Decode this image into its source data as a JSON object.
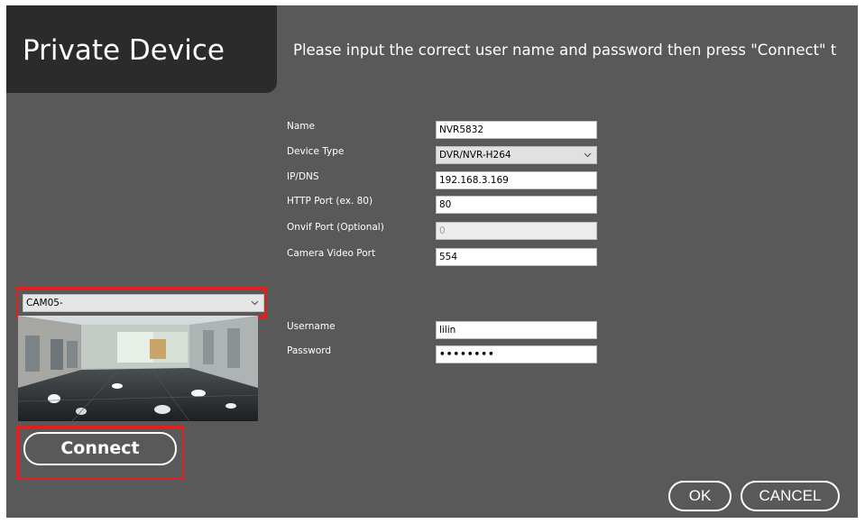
{
  "title": "Private Device",
  "instruction": "Please input the correct user name and password then press \"Connect\" t",
  "form": {
    "name": {
      "label": "Name",
      "value": "NVR5832"
    },
    "device_type": {
      "label": "Device Type",
      "value": "DVR/NVR-H264"
    },
    "ip_dns": {
      "label": "IP/DNS",
      "value": "192.168.3.169"
    },
    "http_port": {
      "label": "HTTP Port (ex. 80)",
      "value": "80"
    },
    "onvif_port": {
      "label": "Onvif Port (Optional)",
      "value": "0"
    },
    "camera_video_port": {
      "label": "Camera Video Port",
      "value": "554"
    },
    "username": {
      "label": "Username",
      "value": "lilin"
    },
    "password": {
      "label": "Password",
      "value": "••••••••"
    }
  },
  "camera_select": {
    "value": "CAM05-"
  },
  "buttons": {
    "connect": "Connect",
    "ok": "OK",
    "cancel": "CANCEL"
  },
  "colors": {
    "panel_bg": "#595959",
    "title_bg": "#2b2b2b",
    "highlight": "#e0201f"
  }
}
